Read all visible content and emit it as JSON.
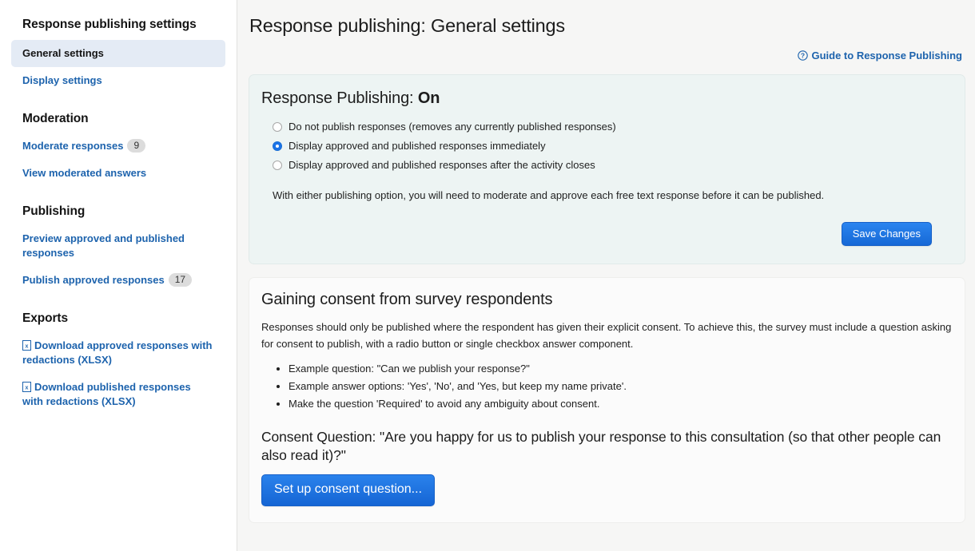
{
  "sidebar": {
    "title": "Response publishing settings",
    "nav": [
      {
        "label": "General settings",
        "active": true
      },
      {
        "label": "Display settings",
        "active": false
      }
    ],
    "sections": [
      {
        "heading": "Moderation",
        "items": [
          {
            "label": "Moderate responses",
            "badge": "9",
            "icon": ""
          },
          {
            "label": "View moderated answers",
            "badge": "",
            "icon": ""
          }
        ]
      },
      {
        "heading": "Publishing",
        "items": [
          {
            "label": "Preview approved and published responses",
            "badge": "",
            "icon": ""
          },
          {
            "label": "Publish approved responses",
            "badge": "17",
            "icon": ""
          }
        ]
      },
      {
        "heading": "Exports",
        "items": [
          {
            "label": "Download approved responses with redactions (XLSX)",
            "badge": "",
            "icon": "xlsx-file-icon"
          },
          {
            "label": "Download published responses with redactions (XLSX)",
            "badge": "",
            "icon": "xlsx-file-icon"
          }
        ]
      }
    ]
  },
  "main": {
    "page_title": "Response publishing: General settings",
    "guide_link": {
      "label": "Guide to Response Publishing",
      "icon": "question-circle-icon"
    },
    "publishing_card": {
      "heading_prefix": "Response Publishing: ",
      "heading_state": "On",
      "options": [
        {
          "label": "Do not publish responses (removes any currently published responses)",
          "checked": false
        },
        {
          "label": "Display approved and published responses immediately",
          "checked": true
        },
        {
          "label": "Display approved and published responses after the activity closes",
          "checked": false
        }
      ],
      "note": "With either publishing option, you will need to moderate and approve each free text response before it can be published.",
      "save_label": "Save Changes"
    },
    "consent_card": {
      "heading": "Gaining consent from survey respondents",
      "intro": "Responses should only be published where the respondent has given their explicit consent. To achieve this, the survey must include a question asking for consent to publish, with a radio button or single checkbox answer component.",
      "bullets": [
        "Example question: \"Can we publish your response?\"",
        "Example answer options: 'Yes', 'No', and 'Yes, but keep my name private'.",
        "Make the question 'Required' to avoid any ambiguity about consent."
      ],
      "consent_question": "Consent Question: \"Are you happy for us to publish your response to this consultation (so that other people can also read it)?\"",
      "setup_button_label": "Set up consent question..."
    }
  },
  "colors": {
    "link": "#1d63ad",
    "accent_button": "#1a73e8",
    "active_nav_bg": "#e4ebf5",
    "teal_card_bg": "#edf4f3",
    "page_bg": "#f6f6f5",
    "badge_bg": "#dcdcdc"
  }
}
